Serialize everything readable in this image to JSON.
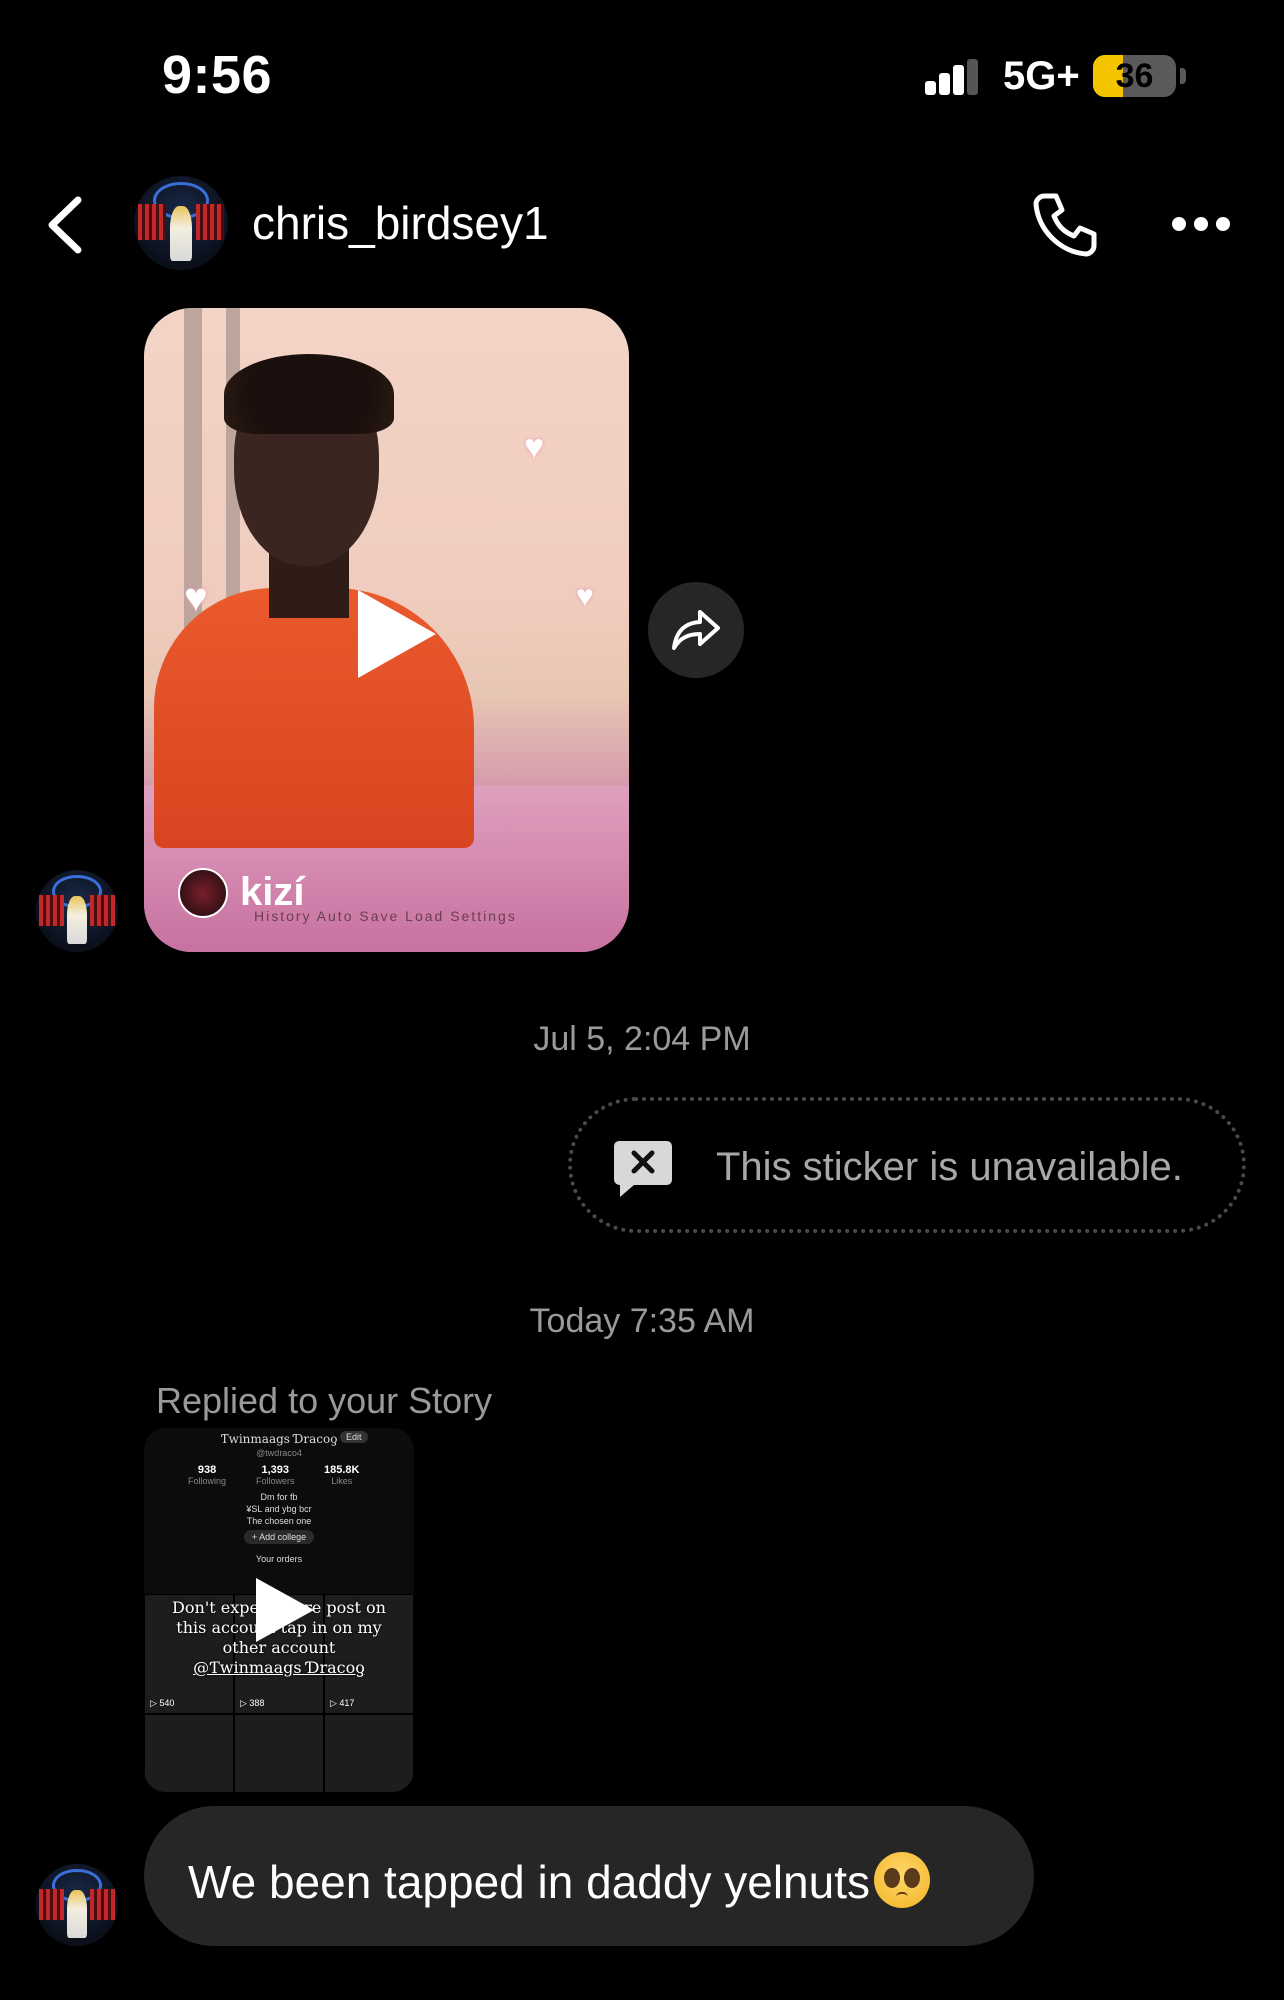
{
  "status_bar": {
    "time": "9:56",
    "network": "5G+",
    "battery": "36",
    "battery_level": 0.36
  },
  "header": {
    "username": "chris_birdsey1",
    "icons": [
      "chevron-left-icon",
      "phone-icon",
      "more-dots-icon"
    ]
  },
  "reel": {
    "username": "kizí",
    "caption_small": "History    Auto  Save  Load  Settings"
  },
  "messages": {
    "timestamp_1": "Jul 5, 2:04 PM",
    "sticker_text": "This sticker is unavailable.",
    "timestamp_2": "Today 7:35 AM",
    "replied_label": "Replied to your Story",
    "story": {
      "profile_name": "Ƭwinmaags Ɗracoƍ",
      "edit": "Edit",
      "handle": "@twdraco4",
      "following": "938",
      "following_label": "Following",
      "followers": "1,393",
      "followers_label": "Followers",
      "likes": "185.8K",
      "likes_label": "Likes",
      "bio_1": "Dm for fb",
      "bio_2": "¥SL and ybg bcr",
      "bio_3": "The chosen one",
      "add_college": "+ Add college",
      "your_orders": "Your orders",
      "overlay_1": "Don't expect more post on",
      "overlay_2": "this account tap in on my",
      "overlay_3": "other account",
      "overlay_4": "@Ƭwinmaags Ɗracoƍ",
      "views_1": "540",
      "views_2": "388",
      "views_3": "417"
    },
    "reply_text": "We been tapped in daddy yelnuts"
  },
  "colors": {
    "background": "#000000",
    "bubble": "#262626",
    "muted_text": "#9a9a9a",
    "battery": "#f5c400"
  }
}
